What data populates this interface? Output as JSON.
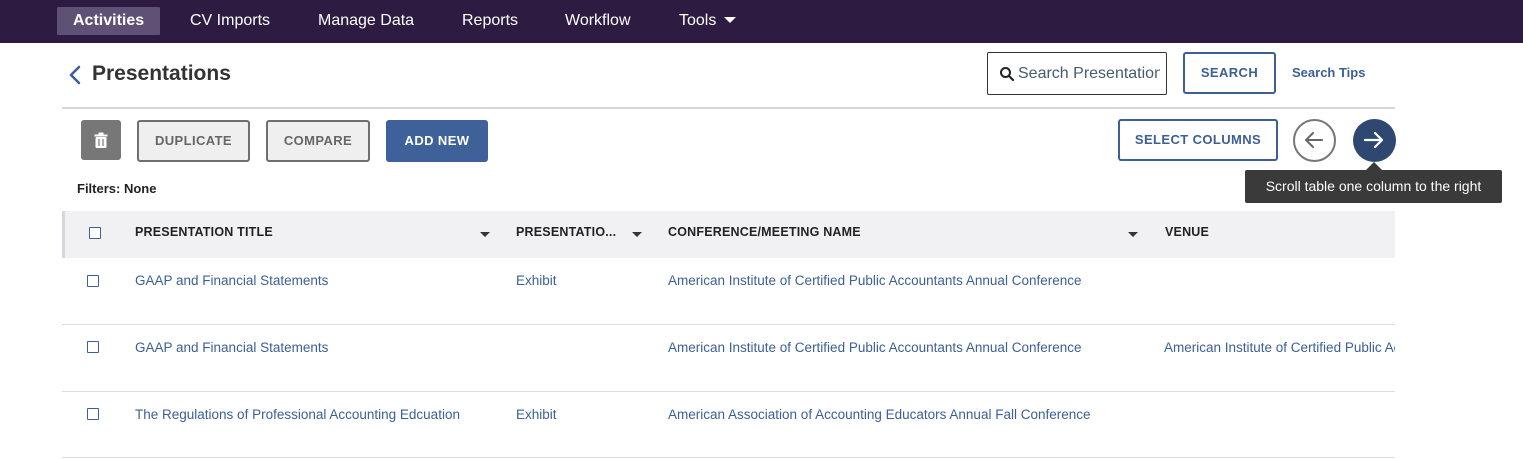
{
  "nav": {
    "items": [
      {
        "label": "Activities",
        "active": true
      },
      {
        "label": "CV Imports"
      },
      {
        "label": "Manage Data"
      },
      {
        "label": "Reports"
      },
      {
        "label": "Workflow"
      },
      {
        "label": "Tools"
      }
    ]
  },
  "header": {
    "title": "Presentations",
    "search_placeholder": "Search Presentations",
    "search_label": "SEARCH",
    "search_tips": "Search Tips"
  },
  "toolbar": {
    "duplicate_label": "DUPLICATE",
    "compare_label": "COMPARE",
    "add_new_label": "ADD NEW",
    "select_columns_label": "SELECT COLUMNS",
    "tooltip": "Scroll table one column to the right"
  },
  "filters": {
    "label": "Filters:",
    "value": "None"
  },
  "table": {
    "columns": [
      "PRESENTATION TITLE",
      "PRESENTATIO...",
      "CONFERENCE/MEETING NAME",
      "VENUE"
    ],
    "rows": [
      {
        "title": "GAAP and Financial Statements",
        "type": "Exhibit",
        "conference": "American Institute of Certified Public Accountants Annual Conference",
        "venue": ""
      },
      {
        "title": "GAAP and Financial Statements",
        "type": "",
        "conference": "American Institute of Certified Public Accountants Annual Conference",
        "venue": "American Institute of Certified Public Accountants"
      },
      {
        "title": "The Regulations of Professional Accounting Edcuation",
        "type": "Exhibit",
        "conference": "American Association of Accounting Educators Annual Fall Conference",
        "venue": ""
      }
    ]
  },
  "colors": {
    "nav_bg": "#2d1b42",
    "accent": "#3c5f96",
    "dark_circle": "#2e4872"
  },
  "icons": [
    "chevron-left-icon",
    "search-icon",
    "trash-icon",
    "arrow-left-icon",
    "arrow-right-icon",
    "chevron-down-icon",
    "sort-caret-icon",
    "checkbox-icon"
  ]
}
